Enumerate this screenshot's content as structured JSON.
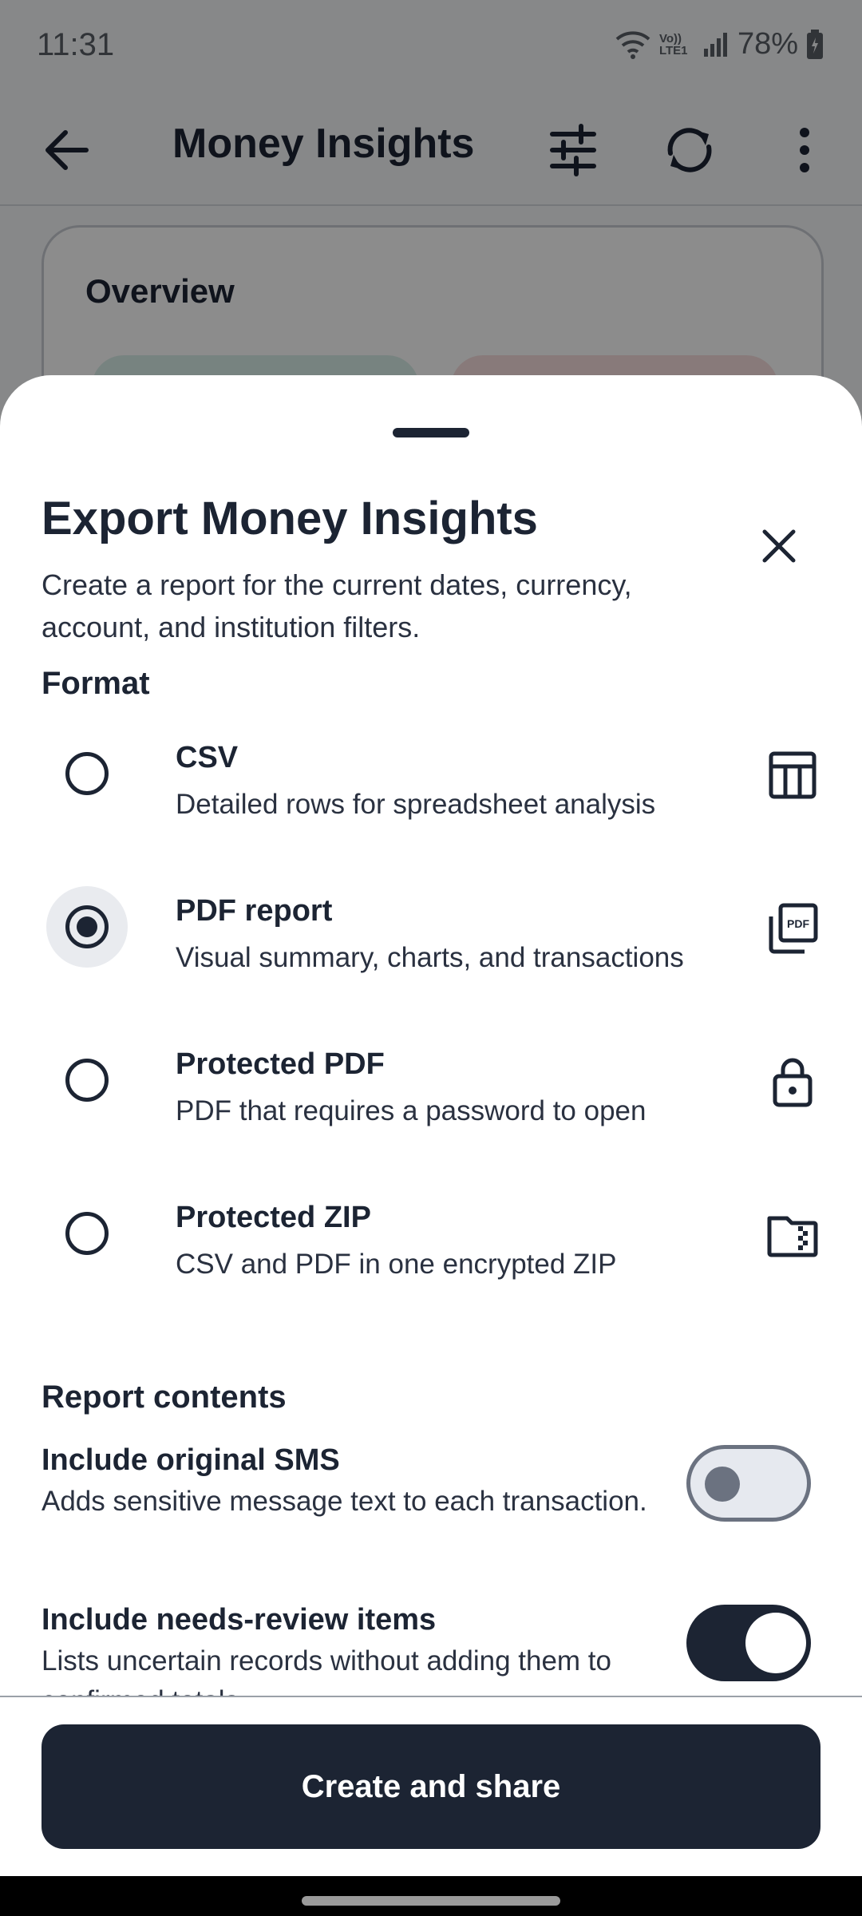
{
  "status_bar": {
    "time": "11:31",
    "battery": "78%",
    "network": "Vo)) LTE1"
  },
  "app_bar": {
    "title": "Money Insights",
    "icons": [
      "back-arrow-icon",
      "filter-sliders-icon",
      "sync-icon",
      "more-vert-icon"
    ]
  },
  "background": {
    "overview_title": "Overview"
  },
  "sheet": {
    "title": "Export Money Insights",
    "description": "Create a report for the current dates, currency, account, and institution filters.",
    "format_label": "Format",
    "options": [
      {
        "title": "CSV",
        "subtitle": "Detailed rows for spreadsheet analysis",
        "icon": "table-icon",
        "selected": false
      },
      {
        "title": "PDF report",
        "subtitle": "Visual summary, charts, and transactions",
        "icon": "pdf-icon",
        "selected": true
      },
      {
        "title": "Protected PDF",
        "subtitle": "PDF that requires a password to open",
        "icon": "lock-icon",
        "selected": false
      },
      {
        "title": "Protected ZIP",
        "subtitle": "CSV and PDF in one encrypted ZIP",
        "icon": "zip-folder-icon",
        "selected": false
      }
    ],
    "contents_label": "Report contents",
    "toggles": [
      {
        "title": "Include original SMS",
        "subtitle": "Adds sensitive message text to each transaction.",
        "on": false
      },
      {
        "title": "Include needs-review items",
        "subtitle": "Lists uncertain records without adding them to confirmed totals.",
        "on": true
      }
    ],
    "primary_button": "Create and share"
  },
  "colors": {
    "ink": "#1c2433",
    "scrim": "rgba(0,0,0,0.45)",
    "overview_green": "#d9eee9",
    "overview_red": "#f7dede"
  }
}
